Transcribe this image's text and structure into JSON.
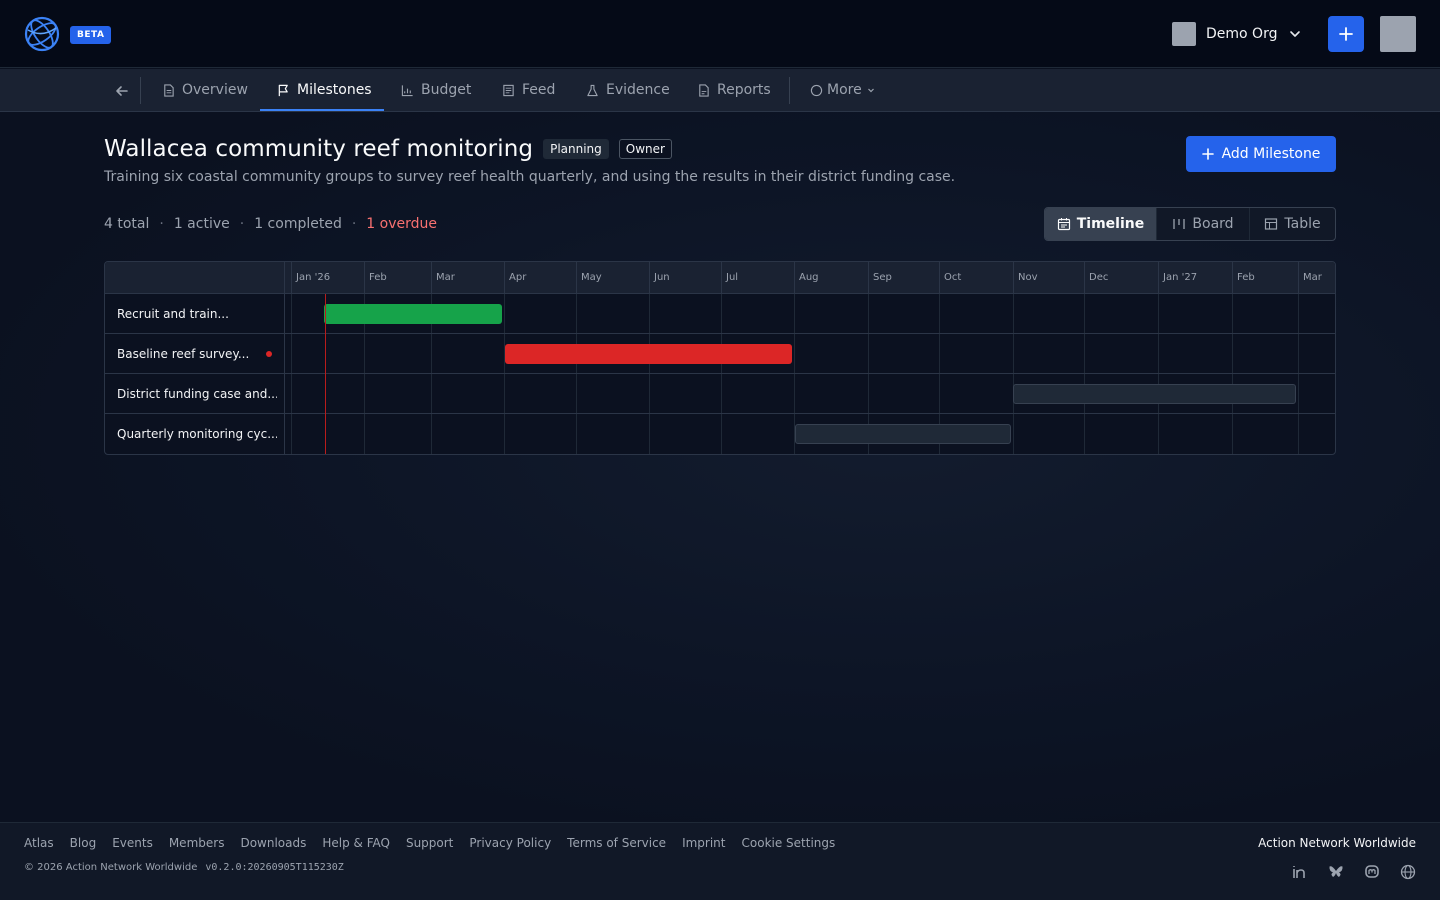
{
  "header": {
    "badge": "BETA",
    "org_name": "Demo Org"
  },
  "tabs": [
    {
      "label": "Overview",
      "icon": "document-icon"
    },
    {
      "label": "Milestones",
      "icon": "flag-icon",
      "active": true
    },
    {
      "label": "Budget",
      "icon": "chart-icon"
    },
    {
      "label": "Feed",
      "icon": "newspaper-icon"
    },
    {
      "label": "Evidence",
      "icon": "flask-icon"
    },
    {
      "label": "Reports",
      "icon": "report-icon"
    },
    {
      "label": "More",
      "icon": "circle-icon"
    }
  ],
  "project": {
    "title": "Wallacea community reef monitoring",
    "status_badge": "Planning",
    "role_badge": "Owner",
    "description": "Training six coastal community groups to survey reef health quarterly, and using the results in their district funding case.",
    "add_button": "Add Milestone"
  },
  "stats": {
    "total": "4 total",
    "active": "1 active",
    "completed": "1 completed",
    "overdue": "1 overdue",
    "separator": "·"
  },
  "view_toggle": {
    "timeline": "Timeline",
    "board": "Board",
    "table": "Table",
    "active": "Timeline"
  },
  "timeline": {
    "months": [
      "Jan '26",
      "Feb",
      "Mar",
      "Apr",
      "May",
      "Jun",
      "Jul",
      "Aug",
      "Sep",
      "Oct",
      "Nov",
      "Dec",
      "Jan '27",
      "Feb",
      "Mar"
    ],
    "milestones": [
      {
        "name": "Recruit and train...",
        "status": "completed",
        "color": "#16a34a",
        "overdue": false
      },
      {
        "name": "Baseline reef survey...",
        "status": "overdue",
        "color": "#dc2626",
        "overdue": true
      },
      {
        "name": "District funding case and...",
        "status": "planned",
        "color": "#1f2937",
        "overdue": false
      },
      {
        "name": "Quarterly monitoring cyc...",
        "status": "planned",
        "color": "#1f2937",
        "overdue": false
      }
    ],
    "today_color": "#b91c1c"
  },
  "footer": {
    "links": [
      "Atlas",
      "Blog",
      "Events",
      "Members",
      "Downloads",
      "Help & FAQ",
      "Support",
      "Privacy Policy",
      "Terms of Service",
      "Imprint",
      "Cookie Settings"
    ],
    "copyright": "© 2026 Action Network Worldwide",
    "version": "v0.2.0:20260905T115230Z",
    "brand": "Action Network Worldwide",
    "social": [
      "linkedin-icon",
      "bluesky-icon",
      "mastodon-icon",
      "globe-icon"
    ]
  },
  "colors": {
    "accent": "#2563eb",
    "completed": "#16a34a",
    "overdue": "#dc2626"
  }
}
